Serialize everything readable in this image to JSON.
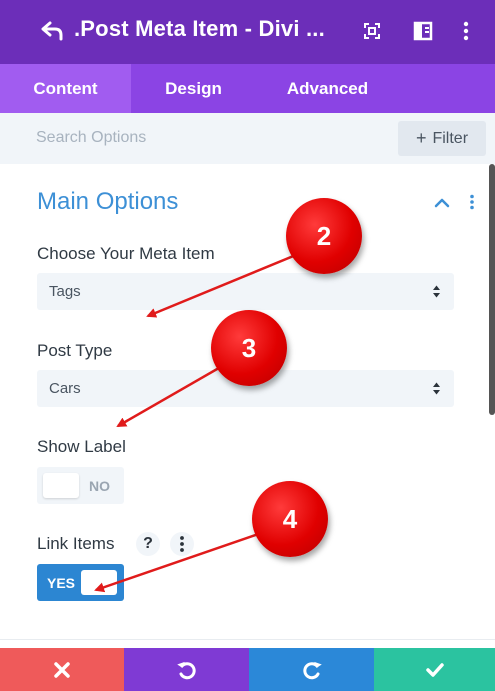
{
  "header": {
    "title": ".Post Meta Item - Divi ...",
    "bg_color": "#6c2eb9",
    "back_icon": "undo-arrow-icon",
    "icons": [
      "fullscreen-icon",
      "sidebar-toggle-icon",
      "more-vertical-icon"
    ]
  },
  "tabs": [
    {
      "label": "Content",
      "active": true
    },
    {
      "label": "Design",
      "active": false
    },
    {
      "label": "Advanced",
      "active": false
    }
  ],
  "search": {
    "placeholder": "Search Options",
    "filter_label": "Filter",
    "filter_prefix": "+"
  },
  "section": {
    "title": "Main Options",
    "accent_color": "#3d90d6"
  },
  "fields": {
    "meta_item": {
      "label": "Choose Your Meta Item",
      "value": "Tags"
    },
    "post_type": {
      "label": "Post Type",
      "value": "Cars"
    },
    "show_label": {
      "label": "Show Label",
      "state": "NO"
    },
    "link_items": {
      "label": "Link Items",
      "help": "?",
      "state": "YES"
    }
  },
  "annotations": [
    "2",
    "3",
    "4"
  ],
  "bottom_bar": [
    {
      "name": "discard",
      "icon": "close-icon",
      "color": "#ef5a5a"
    },
    {
      "name": "undo",
      "icon": "undo-icon",
      "color": "#7f3ad4"
    },
    {
      "name": "redo",
      "icon": "redo-icon",
      "color": "#2b88d8"
    },
    {
      "name": "save",
      "icon": "check-icon",
      "color": "#2bc3a0"
    }
  ]
}
